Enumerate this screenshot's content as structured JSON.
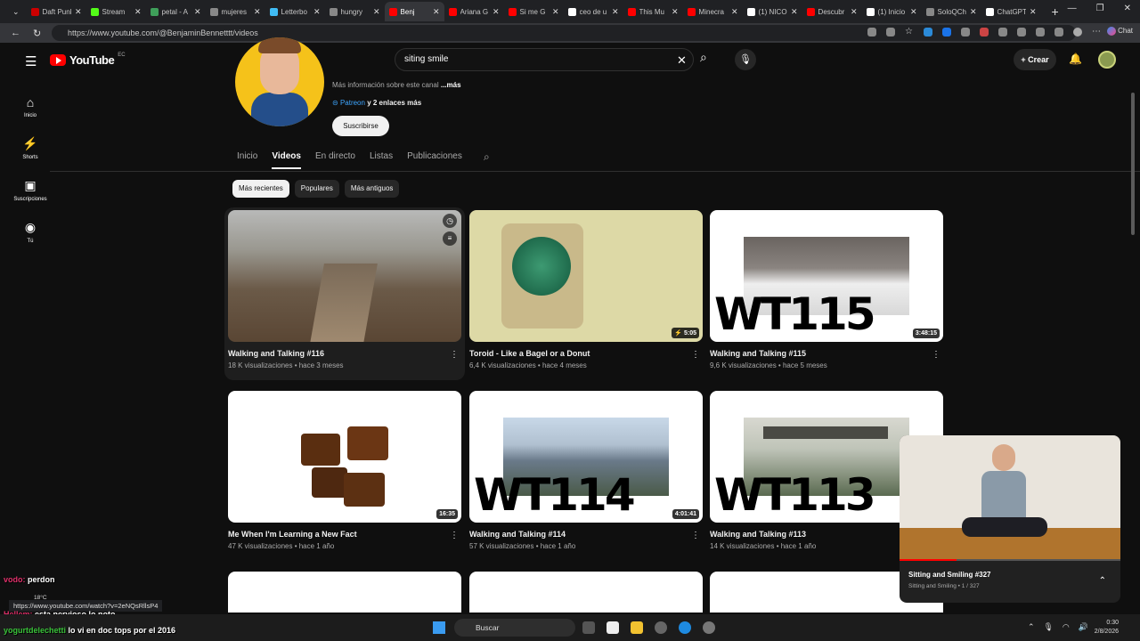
{
  "browser": {
    "tabs": [
      {
        "label": "Daft Punk",
        "color": "#cc0000"
      },
      {
        "label": "Stream",
        "color": "#53fc18"
      },
      {
        "label": "petal - A",
        "color": "#3f9f5a"
      },
      {
        "label": "mujeres",
        "color": "#888888"
      },
      {
        "label": "Letterbo",
        "color": "#40bcf4"
      },
      {
        "label": "hungry",
        "color": "#888888"
      },
      {
        "label": "Benj",
        "color": "#ff0000"
      },
      {
        "label": "Ariana G",
        "color": "#ff0000"
      },
      {
        "label": "Si me G",
        "color": "#ff0000"
      },
      {
        "label": "ceo de u",
        "color": "#ffffff"
      },
      {
        "label": "This Mu",
        "color": "#ff0000"
      },
      {
        "label": "Minecra",
        "color": "#ff0000"
      },
      {
        "label": "(1) NICO",
        "color": "#ffffff"
      },
      {
        "label": "Descubr",
        "color": "#ff0000"
      },
      {
        "label": "(1) Inicio",
        "color": "#ffffff"
      },
      {
        "label": "SoloQCh",
        "color": "#888888"
      },
      {
        "label": "ChatGPT",
        "color": "#ffffff"
      }
    ],
    "url": "https://www.youtube.com/@BenjaminBennetttt/videos",
    "chat_label": "Chat"
  },
  "youtube": {
    "logo": "YouTube",
    "country": "EC",
    "search_query": "siting smile",
    "create_label": "Crear",
    "sidebar": [
      {
        "icon": "⌂",
        "label": "Inicio"
      },
      {
        "icon": "⚡",
        "label": "Shorts"
      },
      {
        "icon": "▣",
        "label": "Suscripciones"
      },
      {
        "icon": "◉",
        "label": "Tú"
      }
    ],
    "channel": {
      "more_info": "Más información sobre este canal",
      "more": "...más",
      "link": "Patreon",
      "links_rest": "y 2 enlaces más",
      "subscribe": "Suscribirse",
      "tabs": [
        "Inicio",
        "Videos",
        "En directo",
        "Listas",
        "Publicaciones"
      ],
      "active_tab": "Videos"
    },
    "chips": [
      "Más recientes",
      "Populares",
      "Más antiguos"
    ],
    "videos": [
      {
        "title": "Walking and Talking #116",
        "meta": "18 K visualizaciones • hace 3 meses",
        "duration": ""
      },
      {
        "title": "Toroid - Like a Bagel or a Donut",
        "meta": "6,4 K visualizaciones • hace 4 meses",
        "duration": "5:05"
      },
      {
        "title": "Walking and Talking #115",
        "meta": "9,6 K visualizaciones • hace 5 meses",
        "duration": "3:48:15",
        "overlay": "WT115"
      },
      {
        "title": "Me When I'm Learning a New Fact",
        "meta": "47 K visualizaciones • hace 1 año",
        "duration": "16:35"
      },
      {
        "title": "Walking and Talking #114",
        "meta": "57 K visualizaciones • hace 1 año",
        "duration": "4:01:41",
        "overlay": "WT114"
      },
      {
        "title": "Walking and Talking #113",
        "meta": "14 K visualizaciones • hace 1 año",
        "duration": "",
        "overlay": "WT113"
      }
    ],
    "miniplayer": {
      "title": "Sitting and Smiling #327",
      "subtitle": "Sitting and Smiling • 1 / 327",
      "progress": 0.26
    }
  },
  "overlay": {
    "chat1_user": "vodo:",
    "chat1_text": "perdon",
    "chat2_user": "Hellem:",
    "chat2_text": "esta nervioso lo noto",
    "chat3_user": "yogurtdelechetti",
    "chat3_text": "lo vi en doc tops por el 2016",
    "url_hint": "https://www.youtube.com/watch?v=2eNQsRllsP4",
    "weather": "18°C"
  },
  "taskbar": {
    "search_label": "Buscar",
    "time": "0:30",
    "date": "2/8/2026"
  }
}
